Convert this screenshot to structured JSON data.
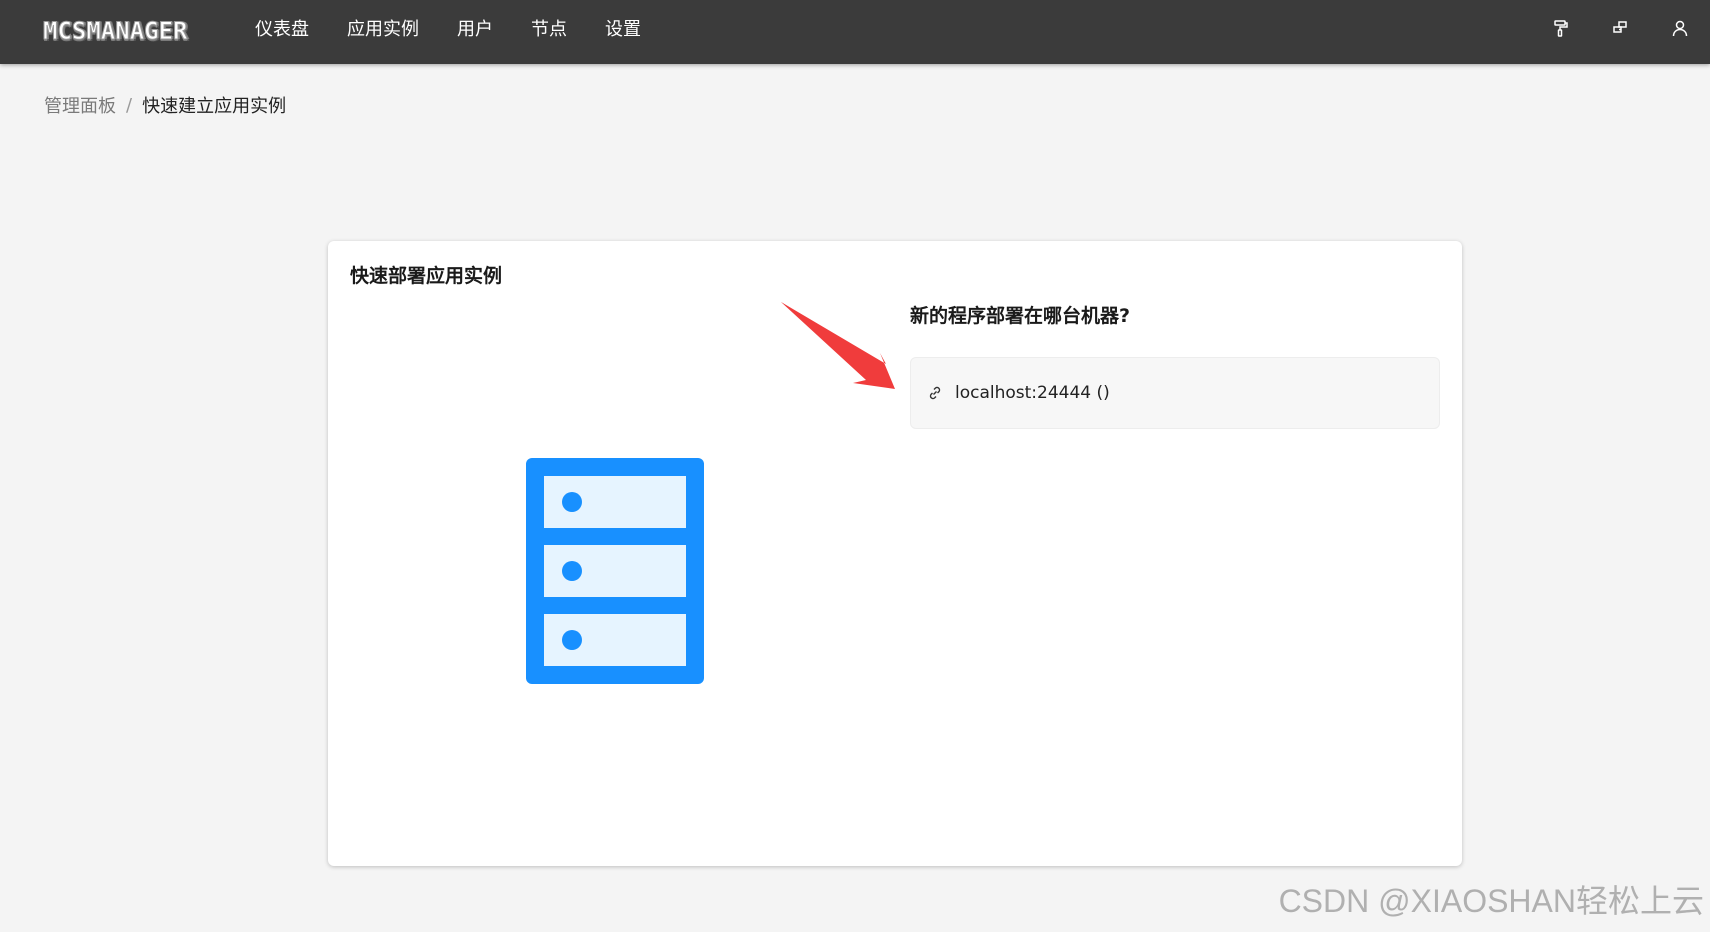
{
  "brand": {
    "logo_text": "MCSMANAGER"
  },
  "nav": {
    "items": [
      {
        "label": "仪表盘"
      },
      {
        "label": "应用实例"
      },
      {
        "label": "用户"
      },
      {
        "label": "节点"
      },
      {
        "label": "设置"
      }
    ]
  },
  "header_icons": [
    "paint-roller-icon",
    "layout-icon",
    "user-icon"
  ],
  "breadcrumb": {
    "root": "管理面板",
    "separator": "/",
    "current": "快速建立应用实例"
  },
  "card": {
    "title": "快速部署应用实例",
    "question": "新的程序部署在哪台机器?",
    "node_option": {
      "label": "localhost:24444 ()",
      "icon": "link-icon"
    },
    "illustration": "server-rack-icon"
  },
  "watermark": "CSDN @XIAOSHAN轻松上云",
  "colors": {
    "topbar": "#3b3b3b",
    "accent": "#1890ff",
    "annotation_arrow": "#f03c3c"
  }
}
